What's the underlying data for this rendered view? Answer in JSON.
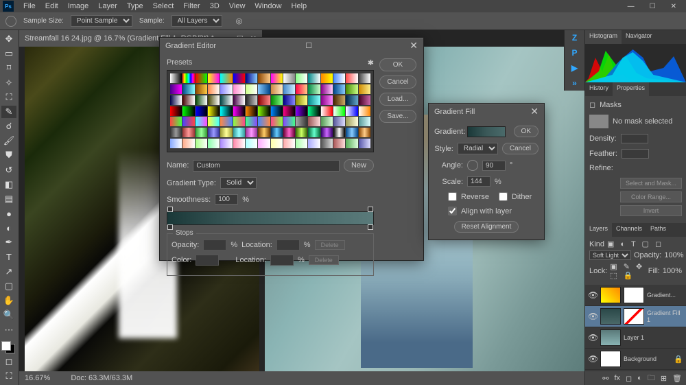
{
  "menu": {
    "items": [
      "File",
      "Edit",
      "Image",
      "Layer",
      "Type",
      "Select",
      "Filter",
      "3D",
      "View",
      "Window",
      "Help"
    ]
  },
  "options": {
    "sampleSizeLabel": "Sample Size:",
    "sampleSizeValue": "Point Sample",
    "sampleLabel": "Sample:",
    "sampleValue": "All Layers"
  },
  "document": {
    "tab": "Streamfall 16 24.jpg @ 16.7% (Gradient Fill 1, RGB/8*) *",
    "zoom": "16.67%",
    "docInfo": "Doc: 63.3M/63.3M"
  },
  "panels": {
    "histogramTabs": [
      "Histogram",
      "Navigator"
    ],
    "propsTabs": [
      "History",
      "Properties"
    ],
    "props": {
      "title": "Masks",
      "noMask": "No mask selected",
      "density": "Density:",
      "feather": "Feather:",
      "refine": "Refine:",
      "btnSelect": "Select and Mask...",
      "btnColor": "Color Range...",
      "btnInvert": "Invert"
    },
    "layersTabs": [
      "Layers",
      "Channels",
      "Paths"
    ],
    "layersCtrl": {
      "kind": "Kind",
      "blend": "Soft Light",
      "opacityLabel": "Opacity:",
      "opacity": "100%",
      "lockLabel": "Lock:",
      "fillLabel": "Fill:",
      "fill": "100%"
    },
    "layers": [
      {
        "name": "Gradient...",
        "sel": false
      },
      {
        "name": "Gradient Fill 1",
        "sel": true
      },
      {
        "name": "Layer 1",
        "sel": false
      },
      {
        "name": "Background",
        "sel": false,
        "locked": true
      }
    ]
  },
  "gradientFill": {
    "title": "Gradient Fill",
    "gradientLabel": "Gradient:",
    "styleLabel": "Style:",
    "style": "Radial",
    "angleLabel": "Angle:",
    "angle": "90",
    "scaleLabel": "Scale:",
    "scale": "144",
    "pct": "%",
    "reverse": "Reverse",
    "dither": "Dither",
    "align": "Align with layer",
    "reset": "Reset Alignment",
    "ok": "OK",
    "cancel": "Cancel"
  },
  "gradientEditor": {
    "title": "Gradient Editor",
    "presetsLabel": "Presets",
    "nameLabel": "Name:",
    "name": "Custom",
    "new": "New",
    "typeLabel": "Gradient Type:",
    "type": "Solid",
    "smoothLabel": "Smoothness:",
    "smooth": "100",
    "pct": "%",
    "stopsLabel": "Stops",
    "opacityLabel": "Opacity:",
    "locationLabel": "Location:",
    "colorLabel": "Color:",
    "delete": "Delete",
    "ok": "OK",
    "cancel": "Cancel",
    "load": "Load...",
    "save": "Save...",
    "presetGradients": [
      "#fff,#000",
      "#f00,#ff0,#0f0,#0ff,#00f,#f0f,#f00",
      "#f00,#0f0",
      "#ff0,#f0f",
      "#0ff,#f80",
      "#00f,#f00",
      "#008,#8cf",
      "#840,#fc8",
      "#f0f,#ff0",
      "#fff,#888",
      "#8f8,#fff",
      "#088,#fff",
      "#f80,#ff0",
      "#48f,#fff",
      "#f44,#fff",
      "#444,#fff",
      "#408,#f0f",
      "#048,#8ff",
      "#840,#fc4",
      "#f84,#fff",
      "#88f,#fff",
      "#f8c,#fff",
      "#cf8,#fff",
      "#8cf,#048",
      "#c84,#fec",
      "#48c,#cef",
      "#f04,#fc8",
      "#084,#cfc",
      "#808,#fcf",
      "#048,#8cf",
      "#480,#cf8",
      "#c80,#fe8",
      "#004,#fff",
      "#400,#fff",
      "#040,#fff",
      "#440,#fff",
      "#044,#fff",
      "#404,#fff",
      "#222,#ccc",
      "#800,#f88",
      "#080,#8f8",
      "#008,#88f",
      "#880,#ff8",
      "#088,#8ff",
      "#808,#f8f",
      "#420,#ca6",
      "#024,#6ac",
      "#402,#c6a",
      "#f00,#000",
      "#0f0,#000",
      "#00f,#000",
      "#ff0,#000",
      "#0ff,#000",
      "#f0f,#000",
      "#f80,#000",
      "#8f0,#000",
      "#08f,#000",
      "#f08,#000",
      "#80f,#000",
      "#0f8,#000",
      "#fff,#f00",
      "#fff,#0f0",
      "#fff,#00f",
      "#fff,#f80",
      "#f44,#4f4",
      "#44f,#f44",
      "#4ff,#f4f",
      "#ff4,#4ff",
      "#f84,#48f",
      "#8f4,#f48",
      "#4f8,#84f",
      "#48f,#f84",
      "#f48,#8f4",
      "#84f,#4f8",
      "#aaa,#333",
      "#955,#fdd",
      "#595,#dfd",
      "#559,#ddf",
      "#995,#ffd",
      "#599,#dff",
      "#333,#999,#333",
      "#933,#f99,#933",
      "#393,#9f9,#393",
      "#339,#99f,#339",
      "#993,#ff9,#993",
      "#399,#9ff,#399",
      "#939,#f9f,#939",
      "#630,#fc6,#630",
      "#036,#6cf,#036",
      "#603,#f6c,#603",
      "#360,#cf6,#360",
      "#063,#6fc,#063",
      "#306,#c6f,#306",
      "#000,#fff,#000",
      "#048,#8cf,#048",
      "#840,#fc8,#840",
      "#8af,#fff",
      "#fa8,#fff",
      "#af8,#fff",
      "#8fa,#fff",
      "#a8f,#fff",
      "#f8a,#fff",
      "#aff,#fff",
      "#faf,#fff",
      "#ffa,#fff",
      "#faa,#fff",
      "#afa,#fff",
      "#aaf,#fff",
      "#555,#ddd",
      "#a55,#fdd",
      "#5a5,#dfd",
      "#55a,#ddf"
    ]
  }
}
